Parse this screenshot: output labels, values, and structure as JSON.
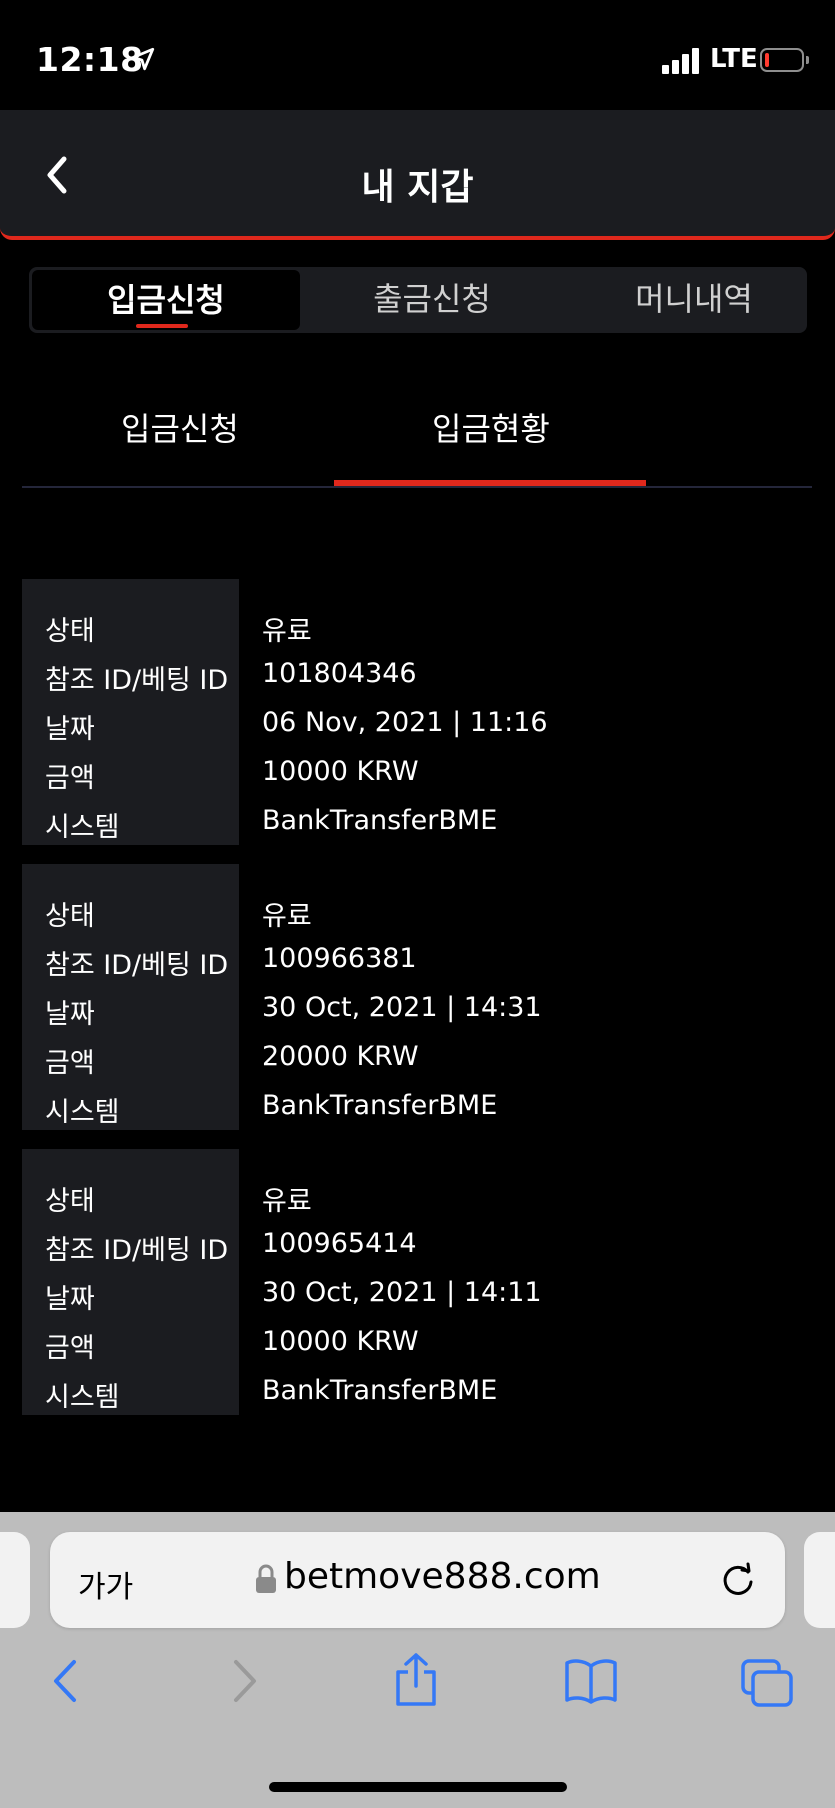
{
  "status_bar": {
    "time": "12:18",
    "network": "LTE"
  },
  "header": {
    "title": "내 지갑"
  },
  "segment_tabs": [
    {
      "label": "입금신청",
      "active": true
    },
    {
      "label": "출금신청",
      "active": false
    },
    {
      "label": "머니내역",
      "active": false
    }
  ],
  "sub_tabs": [
    {
      "label": "입금신청",
      "active": false
    },
    {
      "label": "입금현황",
      "active": true
    }
  ],
  "field_labels": {
    "status": "상태",
    "ref_id": "참조 ID/베팅 ID",
    "date": "날짜",
    "amount": "금액",
    "system": "시스템"
  },
  "records": [
    {
      "status": "유료",
      "ref_id": "101804346",
      "date": "06 Nov, 2021 | 11:16",
      "amount": "10000 KRW",
      "system": "BankTransferBME"
    },
    {
      "status": "유료",
      "ref_id": "100966381",
      "date": "30 Oct, 2021 | 14:31",
      "amount": "20000 KRW",
      "system": "BankTransferBME"
    },
    {
      "status": "유료",
      "ref_id": "100965414",
      "date": "30 Oct, 2021 | 14:11",
      "amount": "10000 KRW",
      "system": "BankTransferBME"
    }
  ],
  "browser": {
    "text_size_label": "가가",
    "url": "betmove888.com"
  },
  "colors": {
    "accent": "#e0281c",
    "panel": "#1b1c20",
    "ios_blue": "#3478f6"
  }
}
